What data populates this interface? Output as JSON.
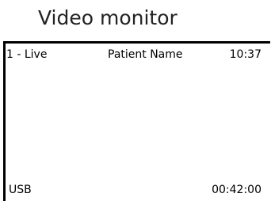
{
  "title": "Video monitor",
  "monitor": {
    "channel": "1 - Live",
    "patient_name": "Patient Name",
    "clock": "10:37",
    "storage": "USB",
    "elapsed": "00:42:00"
  }
}
